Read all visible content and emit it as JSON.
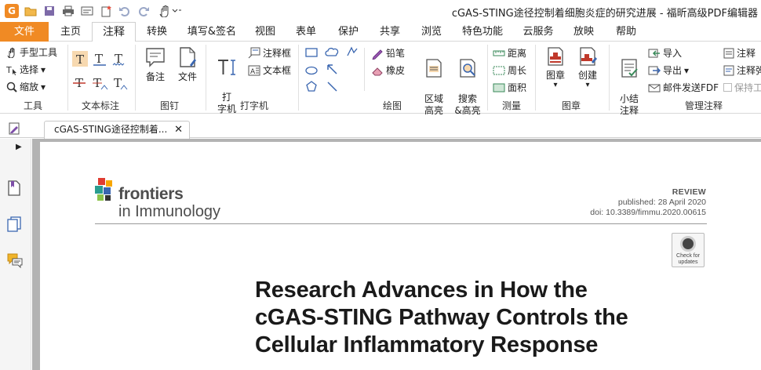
{
  "app": {
    "window_title": "cGAS-STING途径控制着细胞炎症的研究进展 - 福昕高级PDF编辑器"
  },
  "menu": {
    "tabs": [
      {
        "label": "文件"
      },
      {
        "label": "主页"
      },
      {
        "label": "注释"
      },
      {
        "label": "转换"
      },
      {
        "label": "填写&签名"
      },
      {
        "label": "视图"
      },
      {
        "label": "表单"
      },
      {
        "label": "保护"
      },
      {
        "label": "共享"
      },
      {
        "label": "浏览"
      },
      {
        "label": "特色功能"
      },
      {
        "label": "云服务"
      },
      {
        "label": "放映"
      },
      {
        "label": "帮助"
      }
    ]
  },
  "ribbon": {
    "tools": {
      "hand": "手型工具",
      "select": "选择",
      "zoom": "缩放",
      "group": "工具"
    },
    "text_markup": {
      "group": "文本标注"
    },
    "pin": {
      "note": "备注",
      "file": "文件",
      "group": "图钉"
    },
    "typewriter": {
      "typewriter": "打\n字机",
      "callout": "注释框",
      "textbox": "文本框",
      "group": "打字机"
    },
    "drawing": {
      "pencil": "铅笔",
      "eraser": "橡皮",
      "area": "区域\n高亮",
      "search_hl": "搜索\n&高亮",
      "group": "绘图"
    },
    "measure": {
      "distance": "距离",
      "perimeter": "周长",
      "area": "面积",
      "group": "测量"
    },
    "stamp": {
      "stamp": "图章",
      "create": "创建",
      "group": "图章"
    },
    "manage": {
      "summary": "小结\n注释",
      "import": "导入",
      "export": "导出",
      "email_fdf": "邮件发送FDF",
      "comment1": "注释",
      "comment2": "注释弹",
      "keep": "保持工",
      "group": "管理注释"
    }
  },
  "doc_tab": {
    "label": "cGAS-STING途径控制着...",
    "close": "✕"
  },
  "document": {
    "journal_name_line1": "frontiers",
    "journal_name_line2": "in Immunology",
    "article_type": "REVIEW",
    "published": "published: 28 April 2020",
    "doi": "doi: 10.3389/fimmu.2020.00615",
    "check_updates": "Check for\nupdates",
    "title_line1": "Research Advances in How the",
    "title_line2": "cGAS-STING Pathway Controls the",
    "title_line3": "Cellular Inflammatory Response"
  },
  "colors": {
    "accent": "#f08a24",
    "viewport_bg": "#b3b3b3",
    "icon_blue": "#3a66b0",
    "icon_red": "#c0392b"
  }
}
